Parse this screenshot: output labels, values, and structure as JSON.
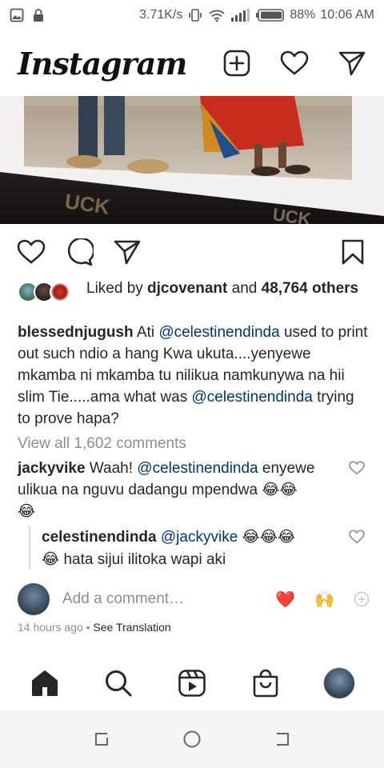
{
  "status_bar": {
    "speed": "3.71K/s",
    "battery": "88%",
    "time": "10:06 AM"
  },
  "header": {
    "logo": "Instagram"
  },
  "post": {
    "likes": {
      "prefix": "Liked by ",
      "user": "djcovenant",
      "middle": " and ",
      "count": "48,764",
      "suffix": " others"
    },
    "caption": {
      "username": "blessednjugush",
      "text_1": " Ati ",
      "mention_1": "@celestinendinda",
      "text_2": " used to print out such ndio a hang Kwa ukuta....yenyewe mkamba ni mkamba tu nilikua namkunywa na hii slim Tie.....ama what was ",
      "mention_2": "@celestinendinda",
      "text_3": " trying to prove hapa?"
    },
    "view_all": "View all 1,602 comments",
    "comment": {
      "username": "jackyvike",
      "text_1": " Waah! ",
      "mention": "@celestinendinda",
      "text_2": " enyewe ulikua na nguvu dadangu mpendwa 😂😂",
      "text_3": "😂"
    },
    "reply": {
      "username": "celestinendinda",
      "mention": "@jackyvike",
      "text_1": " 😂😂😂",
      "text_2": "😂 hata sijui ilitoka wapi aki"
    },
    "add_comment": {
      "placeholder": "Add a comment…",
      "emoji_1": "❤️",
      "emoji_2": "🙌"
    },
    "time_ago": "14 hours ago",
    "separator": " • ",
    "see_translation": "See Translation"
  },
  "colors": {
    "text": "#262626",
    "muted": "#8e8e8e",
    "mention": "#00376b",
    "heart": "#ed4956"
  }
}
